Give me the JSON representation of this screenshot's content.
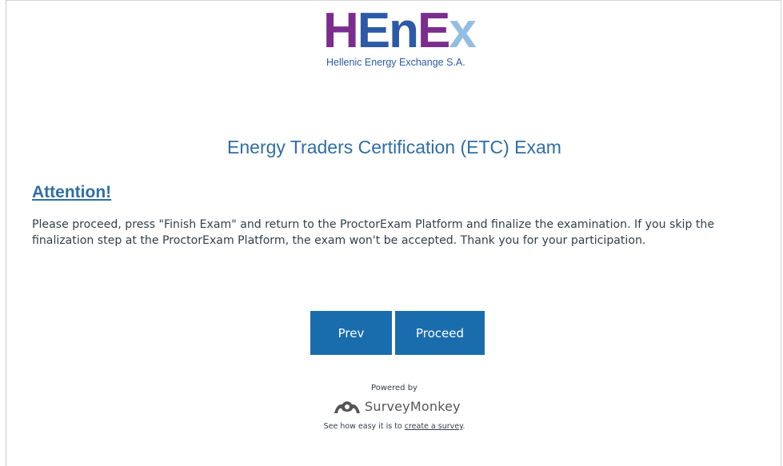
{
  "logo": {
    "letters": [
      "H",
      "En",
      "E",
      "x"
    ],
    "subtitle": "Hellenic Energy Exchange S.A."
  },
  "survey": {
    "title": "Energy Traders Certification (ETC) Exam"
  },
  "notice": {
    "heading": "Attention!",
    "body": "Please proceed, press \"Finish Exam\" and return to the ProctorExam Platform and finalize the examination. If you skip the finalization step at the ProctorExam Platform, the exam won't be accepted. Thank you for your participation."
  },
  "nav": {
    "prev_label": "Prev",
    "proceed_label": "Proceed"
  },
  "footer": {
    "powered_by": "Powered by",
    "brand_name": "SurveyMonkey",
    "brand_mark": "·",
    "tagline_prefix": "See how easy it is to ",
    "tagline_link": "create a survey",
    "tagline_suffix": "."
  },
  "colors": {
    "primary": "#1a6dad",
    "title_blue": "#2f6ea5",
    "logo_purple": "#7b2d8e",
    "logo_blue": "#2d5aa8",
    "body_text": "#333e48"
  }
}
